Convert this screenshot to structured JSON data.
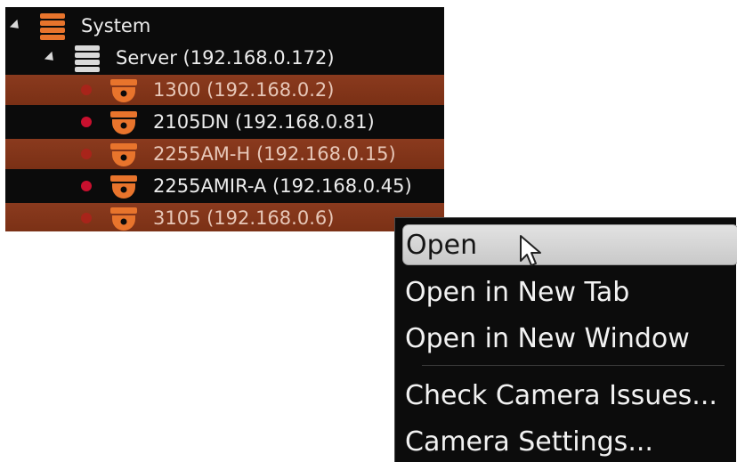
{
  "tree": {
    "root": {
      "label": "System",
      "icon": "server-stack-icon",
      "expanded": true
    },
    "server": {
      "label": "Server (192.168.0.172)",
      "icon": "server-stack-icon",
      "expanded": true
    },
    "cameras": [
      {
        "label": "1300 (192.168.0.2)",
        "status_color": "#c8102e",
        "highlighted": true
      },
      {
        "label": "2105DN (192.168.0.81)",
        "status_color": "#c8102e",
        "highlighted": false
      },
      {
        "label": "2255AM-H (192.168.0.15)",
        "status_color": "#c8102e",
        "highlighted": true
      },
      {
        "label": "2255AMIR-A (192.168.0.45)",
        "status_color": "#c8102e",
        "highlighted": false
      },
      {
        "label": "3105 (192.168.0.6)",
        "status_color": "#c8102e",
        "highlighted": true
      }
    ]
  },
  "context_menu": {
    "items": [
      {
        "label": "Open",
        "active": true
      },
      {
        "label": "Open in New Tab"
      },
      {
        "label": "Open in New Window"
      },
      {
        "label": "Check Camera Issues..."
      },
      {
        "label": "Camera Settings..."
      }
    ]
  },
  "colors": {
    "panel_bg": "#0b0b0b",
    "highlight_row": "#8a3a1e",
    "icon_orange": "#e8742c",
    "status_dot": "#c8102e"
  }
}
